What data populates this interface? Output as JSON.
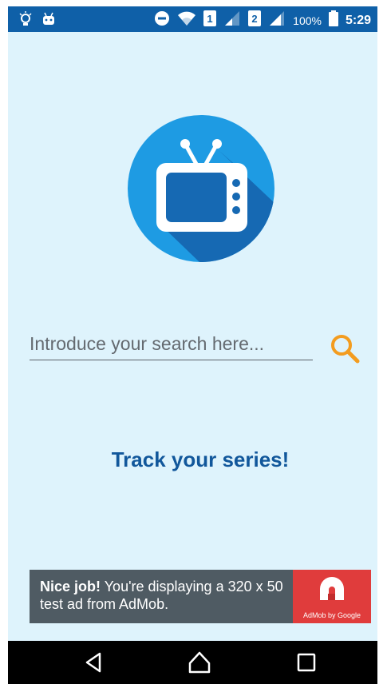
{
  "status_bar": {
    "icons": [
      "lightbulb-icon",
      "android-icon",
      "do-not-disturb-icon",
      "wifi-icon",
      "sim-1-icon",
      "signal-icon",
      "sim-2-icon",
      "signal-icon",
      "battery-icon"
    ],
    "sim1": "1",
    "sim2": "2",
    "battery": "100%",
    "time": "5:29"
  },
  "colors": {
    "status_bar": "#0f60a8",
    "background": "#def3fc",
    "logo_circle": "#1e9be3",
    "logo_shadow": "#1669b3",
    "tagline": "#11579b",
    "search_icon": "#f39c1f",
    "ad_background": "#4f5b63",
    "ad_logo": "#e03c3c"
  },
  "search": {
    "placeholder": "Introduce your search here...",
    "value": ""
  },
  "tagline": "Track your series!",
  "ad": {
    "bold": "Nice job!",
    "text": "You're displaying a 320 x 50 test ad from AdMob.",
    "logo_caption": "AdMob by Google"
  },
  "nav": [
    "back-icon",
    "home-icon",
    "recents-icon"
  ]
}
